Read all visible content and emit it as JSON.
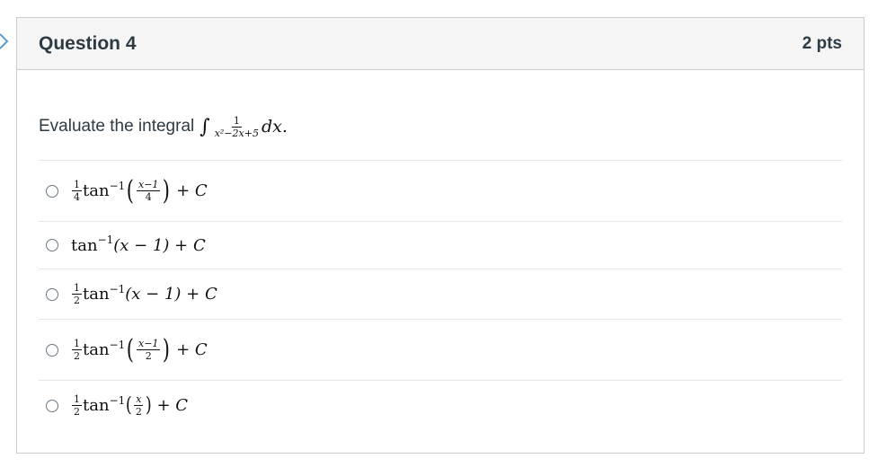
{
  "question": {
    "title": "Question 4",
    "points": "2 pts",
    "prompt_text": "Evaluate the integral",
    "integral": {
      "sign": "∫",
      "numerator": "1",
      "denominator": "x²−2x+5",
      "differential": "dx."
    }
  },
  "answers": [
    {
      "coef_num": "1",
      "coef_den": "4",
      "fn": "tan",
      "exp": "−1",
      "arg_num": "x−1",
      "arg_den": "4",
      "tail": "+ C"
    },
    {
      "fn": "tan",
      "exp": "−1",
      "arg": "(x − 1) + C"
    },
    {
      "coef_num": "1",
      "coef_den": "2",
      "fn": "tan",
      "exp": "−1",
      "arg": "(x − 1) + C"
    },
    {
      "coef_num": "1",
      "coef_den": "2",
      "fn": "tan",
      "exp": "−1",
      "arg_num": "x−1",
      "arg_den": "2",
      "tail": "+ C"
    },
    {
      "coef_num": "1",
      "coef_den": "2",
      "fn": "tan",
      "exp": "−1",
      "arg_num": "x",
      "arg_den": "2",
      "tail": "+ C"
    }
  ],
  "icons": {
    "nav": "chevron-right-icon",
    "radio": "radio-unchecked-icon"
  },
  "colors": {
    "header_bg": "#f5f5f5",
    "border": "#c7cdd1",
    "text": "#2d3b45",
    "nav_chevron": "#5b9bd5"
  }
}
